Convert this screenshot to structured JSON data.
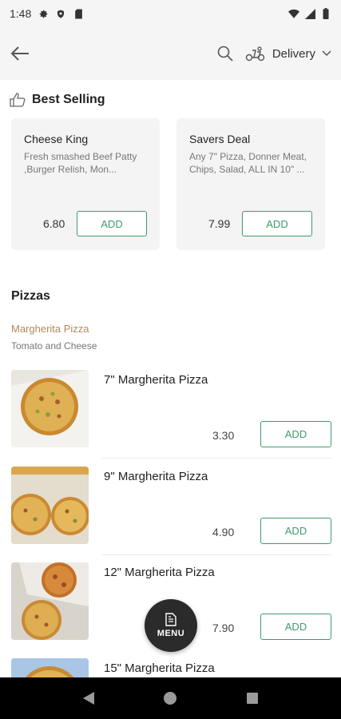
{
  "status_bar": {
    "time": "1:48"
  },
  "header": {
    "delivery_label": "Delivery"
  },
  "best_selling": {
    "title": "Best Selling",
    "items": [
      {
        "name": "Cheese King",
        "description": "Fresh smashed Beef Patty ,Burger Relish, Mon...",
        "price": "6.80",
        "add_label": "ADD"
      },
      {
        "name": "Savers Deal",
        "description": "Any 7\" Pizza, Donner Meat, Chips, Salad, ALL IN 10\" ...",
        "price": "7.99",
        "add_label": "ADD"
      }
    ]
  },
  "pizzas": {
    "title": "Pizzas",
    "subcategory": {
      "name": "Margherita Pizza",
      "description": "Tomato and Cheese"
    },
    "items": [
      {
        "name": "7\" Margherita Pizza",
        "price": "3.30",
        "add_label": "ADD"
      },
      {
        "name": "9\" Margherita Pizza",
        "price": "4.90",
        "add_label": "ADD"
      },
      {
        "name": "12\" Margherita Pizza",
        "price": "7.90",
        "add_label": "ADD"
      },
      {
        "name": "15\" Margherita Pizza"
      }
    ]
  },
  "menu_button": {
    "label": "MENU"
  },
  "colors": {
    "accent": "#3f9b6a",
    "subcategory": "#b08a5a",
    "fab": "#2b2b2b"
  }
}
